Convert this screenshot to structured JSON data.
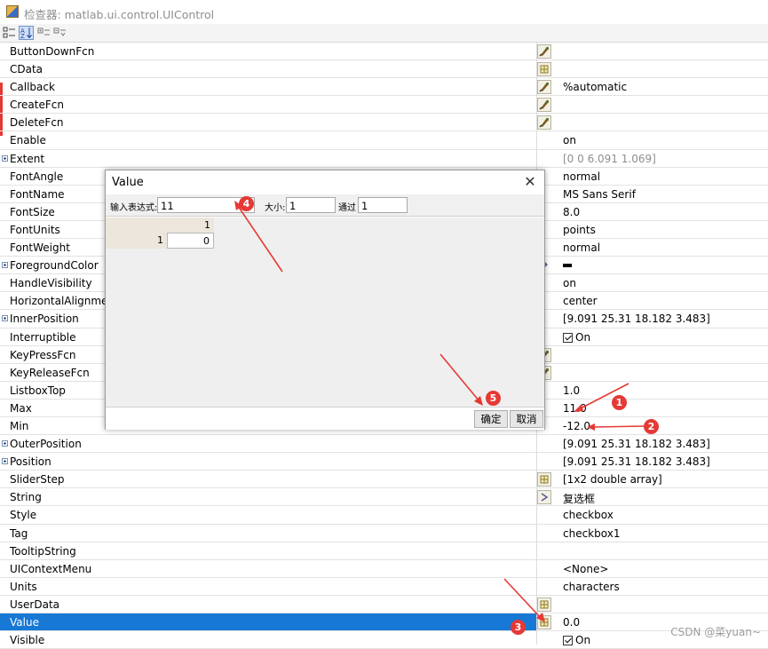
{
  "window": {
    "title": "检查器: matlab.ui.control.UIControl"
  },
  "properties": [
    {
      "name": "ButtonDownFcn",
      "expandable": false,
      "button": "callback",
      "value": ""
    },
    {
      "name": "CData",
      "expandable": false,
      "button": "grid",
      "value": ""
    },
    {
      "name": "Callback",
      "expandable": false,
      "button": "callback",
      "value": "%automatic"
    },
    {
      "name": "CreateFcn",
      "expandable": false,
      "button": "callback",
      "value": ""
    },
    {
      "name": "DeleteFcn",
      "expandable": false,
      "button": "callback",
      "value": ""
    },
    {
      "name": "Enable",
      "expandable": false,
      "button": "",
      "value": "on"
    },
    {
      "name": "Extent",
      "expandable": true,
      "button": "",
      "value": "[0 0 6.091 1.069]",
      "gray": true
    },
    {
      "name": "FontAngle",
      "expandable": false,
      "button": "",
      "value": "normal"
    },
    {
      "name": "FontName",
      "expandable": false,
      "button": "",
      "value": "MS Sans Serif"
    },
    {
      "name": "FontSize",
      "expandable": false,
      "button": "",
      "value": "8.0"
    },
    {
      "name": "FontUnits",
      "expandable": false,
      "button": "",
      "value": "points"
    },
    {
      "name": "FontWeight",
      "expandable": false,
      "button": "",
      "value": "normal"
    },
    {
      "name": "ForegroundColor",
      "expandable": true,
      "button": "color",
      "value": "",
      "swatch": true
    },
    {
      "name": "HandleVisibility",
      "expandable": false,
      "button": "",
      "value": "on"
    },
    {
      "name": "HorizontalAlignment",
      "expandable": false,
      "button": "",
      "value": "center"
    },
    {
      "name": "InnerPosition",
      "expandable": true,
      "button": "",
      "value": "[9.091 25.31 18.182 3.483]"
    },
    {
      "name": "Interruptible",
      "expandable": false,
      "button": "",
      "value": "On",
      "checkbox": true
    },
    {
      "name": "KeyPressFcn",
      "expandable": false,
      "button": "callback",
      "value": ""
    },
    {
      "name": "KeyReleaseFcn",
      "expandable": false,
      "button": "callback",
      "value": ""
    },
    {
      "name": "ListboxTop",
      "expandable": false,
      "button": "",
      "value": "1.0"
    },
    {
      "name": "Max",
      "expandable": false,
      "button": "",
      "value": "11.0"
    },
    {
      "name": "Min",
      "expandable": false,
      "button": "",
      "value": "-12.0"
    },
    {
      "name": "OuterPosition",
      "expandable": true,
      "button": "",
      "value": "[9.091 25.31 18.182 3.483]"
    },
    {
      "name": "Position",
      "expandable": true,
      "button": "",
      "value": "[9.091 25.31 18.182 3.483]"
    },
    {
      "name": "SliderStep",
      "expandable": false,
      "button": "grid",
      "value": "[1x2  double array]"
    },
    {
      "name": "String",
      "expandable": false,
      "button": "text",
      "value": "复选框"
    },
    {
      "name": "Style",
      "expandable": false,
      "button": "",
      "value": "checkbox"
    },
    {
      "name": "Tag",
      "expandable": false,
      "button": "",
      "value": "checkbox1"
    },
    {
      "name": "TooltipString",
      "expandable": false,
      "button": "",
      "value": ""
    },
    {
      "name": "UIContextMenu",
      "expandable": false,
      "button": "",
      "value": "<None>"
    },
    {
      "name": "Units",
      "expandable": false,
      "button": "",
      "value": "characters"
    },
    {
      "name": "UserData",
      "expandable": false,
      "button": "grid",
      "value": ""
    },
    {
      "name": "Value",
      "expandable": false,
      "button": "grid",
      "value": "0.0",
      "selected": true
    },
    {
      "name": "Visible",
      "expandable": false,
      "button": "",
      "value": "On",
      "checkbox": true
    }
  ],
  "dialog": {
    "title": "Value",
    "expr_label": "输入表达式:",
    "expr_value": "11",
    "size_label": "大小:",
    "size_value": "1",
    "by_label": "通过",
    "by_value": "1",
    "col_header": "1",
    "row_header": "1",
    "cell_value": "0",
    "ok_label": "确定",
    "cancel_label": "取消"
  },
  "annotations": [
    {
      "label": "1",
      "color": "#e53935"
    },
    {
      "label": "2",
      "color": "#e53935"
    },
    {
      "label": "3",
      "color": "#e53935"
    },
    {
      "label": "4",
      "color": "#e53935"
    },
    {
      "label": "5",
      "color": "#e53935"
    }
  ],
  "watermark": "CSDN @菜yuan~",
  "colors": {
    "selection": "#1778d6",
    "annotation": "#e53935",
    "dialog_area": "#efefef"
  }
}
